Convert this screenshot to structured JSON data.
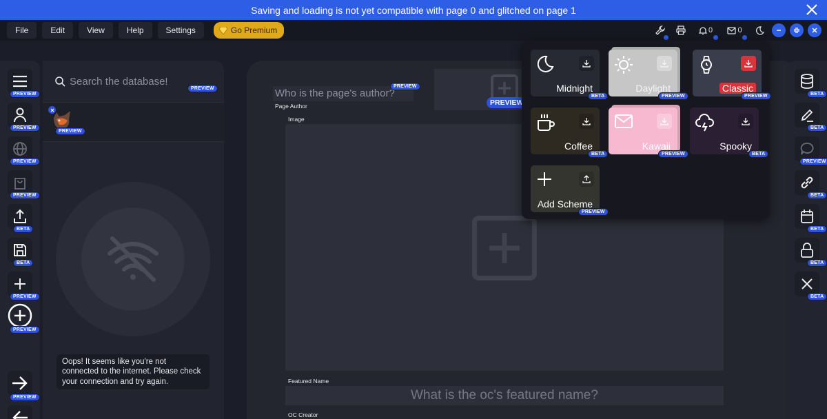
{
  "banner": {
    "text": "Saving and loading is not yet compatible with page 0 and glitched on page 1"
  },
  "menu": {
    "items": [
      "File",
      "Edit",
      "View",
      "Help",
      "Settings"
    ],
    "premium": "Go Premium"
  },
  "toolbar": {
    "notifications_count": "0",
    "messages_count": "0"
  },
  "left_sidebar": {
    "badges": [
      "PREVIEW",
      "PREVIEW",
      "PREVIEW",
      "PREVIEW",
      "BETA",
      "BETA",
      "PREVIEW",
      "PREVIEW",
      "PREVIEW"
    ]
  },
  "left_panel": {
    "search_placeholder": "Search the database!",
    "search_badge": "PREVIEW",
    "avatar_badge": "PREVIEW",
    "offline_message": "Oops! It seems like you're not connected to the internet. Please check your connection and try again."
  },
  "main": {
    "author_placeholder": "Who is the page's author?",
    "author_badge": "PREVIEW",
    "page_author_label": "Page Author",
    "image_label": "Image",
    "top_preview": "PREVIEW",
    "featured_name_label": "Featured Name",
    "featured_name_placeholder": "What is the oc's featured name?",
    "oc_creator_label": "OC Creator"
  },
  "schemes": {
    "cards": [
      {
        "name": "Midnight",
        "badge": "BETA",
        "icon": "moon-icon"
      },
      {
        "name": "Daylight",
        "badge": "PREVIEW",
        "icon": "sun-icon"
      },
      {
        "name": "Classic",
        "badge": "PREVIEW",
        "icon": "watch-icon"
      },
      {
        "name": "Coffee",
        "badge": "BETA",
        "icon": "coffee-icon"
      },
      {
        "name": "Kawaii",
        "badge": "PREVIEW",
        "icon": "mail-icon"
      },
      {
        "name": "Spooky",
        "badge": "BETA",
        "icon": "storm-icon"
      },
      {
        "name": "Add Scheme",
        "badge": "PREVIEW",
        "icon": "plus-icon"
      }
    ]
  },
  "right_sidebar": {
    "badges": [
      "BETA",
      "BETA",
      "PREVIEW",
      "BETA",
      "BETA",
      "BETA",
      "BETA"
    ]
  },
  "colors": {
    "accent": "#2f5ee6",
    "premium": "#e0a91a",
    "classic_red": "#d6363b",
    "kawaii_pink": "#f6b8cf"
  }
}
